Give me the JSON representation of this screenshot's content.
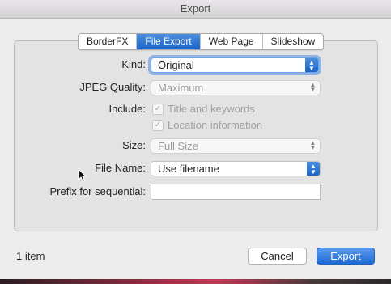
{
  "window": {
    "title": "Export"
  },
  "tabs": [
    {
      "label": "BorderFX",
      "active": false
    },
    {
      "label": "File Export",
      "active": true
    },
    {
      "label": "Web Page",
      "active": false
    },
    {
      "label": "Slideshow",
      "active": false
    }
  ],
  "form": {
    "kind": {
      "label": "Kind:",
      "value": "Original"
    },
    "jpeg_quality": {
      "label": "JPEG Quality:",
      "value": "Maximum"
    },
    "include": {
      "label": "Include:",
      "title_keywords": {
        "label": "Title and keywords",
        "checked": true
      },
      "location_info": {
        "label": "Location information",
        "checked": true
      }
    },
    "size": {
      "label": "Size:",
      "value": "Full Size"
    },
    "file_name": {
      "label": "File Name:",
      "value": "Use filename"
    },
    "prefix": {
      "label": "Prefix for sequential:",
      "value": ""
    }
  },
  "footer": {
    "item_count": "1 item",
    "cancel_label": "Cancel",
    "export_label": "Export"
  },
  "icons": {
    "checkmark": "check-icon",
    "popup_arrows": "up-down-chevron-icon",
    "pointer": "arrow-cursor-icon"
  },
  "colors": {
    "accent": "#1a64c8",
    "window_bg": "#ececec"
  }
}
